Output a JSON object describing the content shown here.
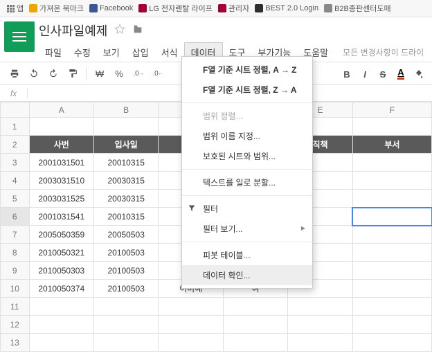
{
  "bookmarks": {
    "apps": "앱",
    "items": [
      {
        "label": "가져온 북마크",
        "color": "#f0a30a"
      },
      {
        "label": "Facebook",
        "color": "#3b5998"
      },
      {
        "label": "LG 전자렌탈 라이프",
        "color": "#a50034"
      },
      {
        "label": "관리자",
        "color": "#a50034"
      },
      {
        "label": "BEST 2.0 Login",
        "color": "#2e2e2e"
      },
      {
        "label": "B2B종판센터도매",
        "color": "#888"
      }
    ]
  },
  "doc": {
    "title": "인사파일예제"
  },
  "menu": {
    "items": [
      "파일",
      "수정",
      "보기",
      "삽입",
      "서식",
      "데이터",
      "도구",
      "부가기능",
      "도움말"
    ],
    "active_index": 5,
    "edge_text": "모든 변경사항이 드라이"
  },
  "toolbar": {
    "currency": "₩",
    "percent": "%",
    "dec": ".0",
    "inc": ".0",
    "bold": "B",
    "italic": "I",
    "strike": "S",
    "color": "A"
  },
  "fx": {
    "label": "fx",
    "value": ""
  },
  "dropdown": {
    "sort_az": "F열 기준 시트 정렬, A → Z",
    "sort_za": "F열 기준 시트 정렬, Z → A",
    "range_sort": "범위 정렬...",
    "range_name": "범위 이름 지정...",
    "protected": "보호된 시트와 범위...",
    "split": "텍스트를 일로 분할...",
    "filter": "필터",
    "filter_view": "필터 보기...",
    "pivot": "피봇 테이블...",
    "validate": "데이터 확인..."
  },
  "grid": {
    "cols": [
      "A",
      "B",
      "",
      "",
      "E",
      "F"
    ],
    "headers": [
      "사번",
      "입사일",
      "",
      "",
      "직책",
      "부서"
    ],
    "rows": [
      [
        "2001031501",
        "20010315",
        "",
        "",
        "",
        ""
      ],
      [
        "2003031510",
        "20030315",
        "",
        "",
        "",
        ""
      ],
      [
        "2003031525",
        "20030315",
        "",
        "",
        "",
        ""
      ],
      [
        "2001031541",
        "20010315",
        "",
        "",
        "",
        ""
      ],
      [
        "2005050359",
        "20050503",
        "",
        "",
        "",
        ""
      ],
      [
        "2010050321",
        "20100503",
        "",
        "",
        "",
        ""
      ],
      [
        "2010050303",
        "20100503",
        "",
        "",
        "",
        ""
      ],
      [
        "2010050374",
        "20100503",
        "이미혜",
        "여",
        "",
        ""
      ]
    ],
    "selected_row": 6,
    "selected_col": 5
  }
}
